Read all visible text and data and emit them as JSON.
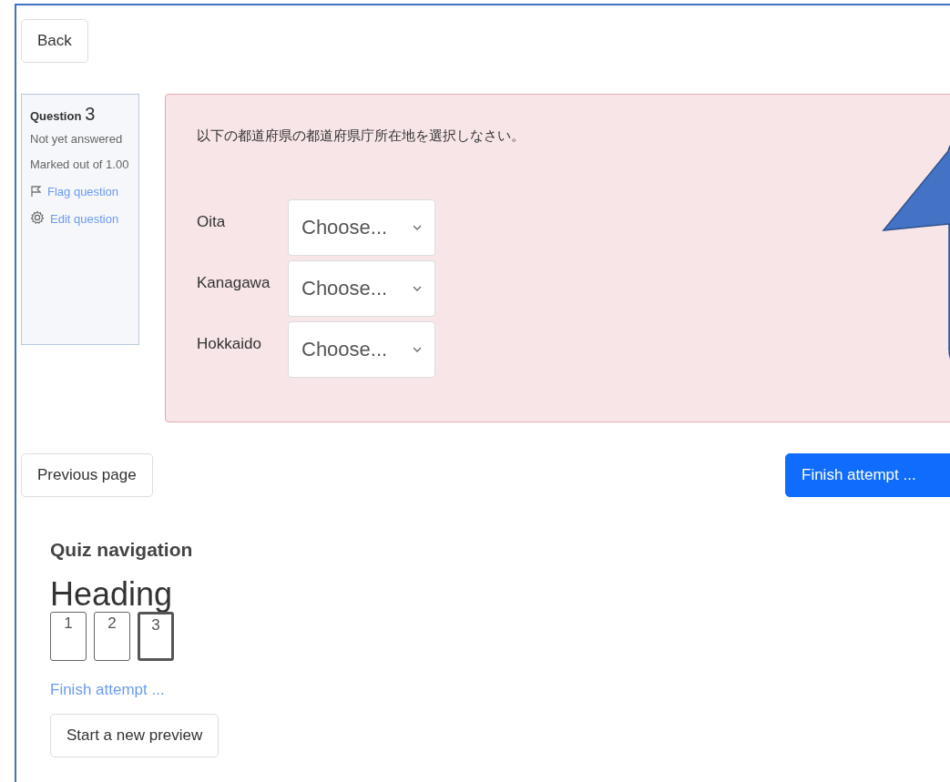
{
  "back_button": "Back",
  "question_info": {
    "title": "Question",
    "number": "3",
    "status": "Not yet answered",
    "marks": "Marked out of 1.00",
    "flag_link": "Flag question",
    "edit_link": "Edit question"
  },
  "question": {
    "prompt": "以下の都道府県の都道府県庁所在地を選択しなさい。",
    "rows": [
      {
        "label": "Oita",
        "value": "Choose..."
      },
      {
        "label": "Kanagawa",
        "value": "Choose..."
      },
      {
        "label": "Hokkaido",
        "value": "Choose..."
      }
    ]
  },
  "page_buttons": {
    "previous": "Previous page",
    "finish": "Finish attempt ..."
  },
  "quiz_navigation": {
    "title": "Quiz navigation",
    "heading": "Heading",
    "questions": [
      {
        "label": "1",
        "selected": false
      },
      {
        "label": "2",
        "selected": false
      },
      {
        "label": "3",
        "selected": true
      }
    ],
    "finish_link": "Finish attempt ...",
    "new_preview": "Start a new preview"
  }
}
